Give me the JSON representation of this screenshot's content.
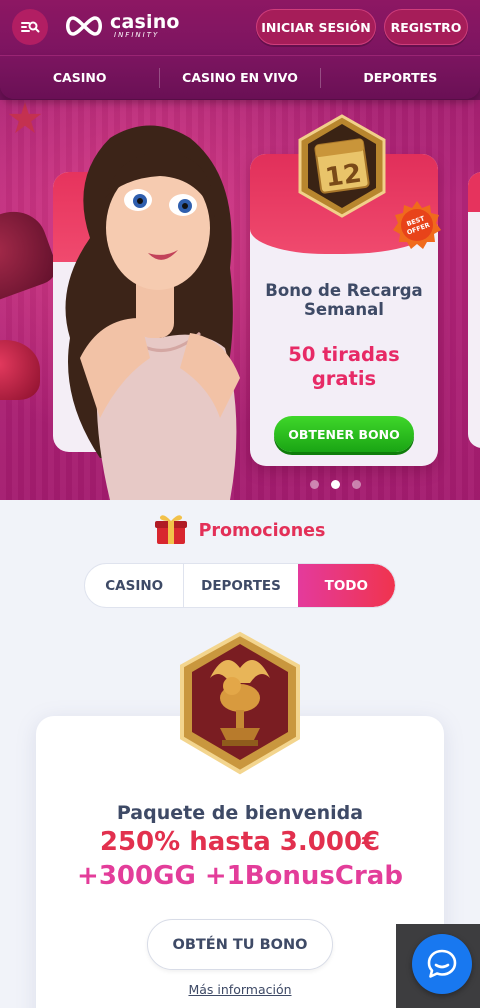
{
  "header": {
    "logo_main": "casino",
    "logo_sub": "INFINITY",
    "login_label": "INICIAR SESIÓN",
    "register_label": "REGISTRO"
  },
  "nav": {
    "items": [
      {
        "label": "CASINO"
      },
      {
        "label": "CASINO EN VIVO"
      },
      {
        "label": "DEPORTES"
      }
    ]
  },
  "hero": {
    "card": {
      "badge_number": "12",
      "best_offer": "BEST OFFER",
      "title_line1": "Bono de Recarga",
      "title_line2": "Semanal",
      "offer_line1": "50 tiradas",
      "offer_line2": "gratis",
      "cta": "OBTENER BONO"
    },
    "slides_total": 3,
    "active_slide": 2
  },
  "promotions": {
    "title": "Promociones",
    "tabs": [
      {
        "label": "CASINO",
        "active": false
      },
      {
        "label": "DEPORTES",
        "active": false
      },
      {
        "label": "TODO",
        "active": true
      }
    ],
    "welcome": {
      "title": "Paquete de bienvenida",
      "line1": "250% hasta 3.000€",
      "line2": "+300GG +1BonusCrab",
      "cta": "OBTÉN TU BONO",
      "more": "Más información"
    }
  },
  "colors": {
    "brand_magenta": "#8d1763",
    "accent_red": "#e2304e",
    "accent_pink": "#e33d9a",
    "cta_green": "#1aa514",
    "chat_blue": "#1878f0"
  },
  "icons": [
    "menu-search-icon",
    "infinity-logo-icon",
    "calendar-icon",
    "gift-icon",
    "lion-trophy-icon",
    "chat-icon"
  ]
}
